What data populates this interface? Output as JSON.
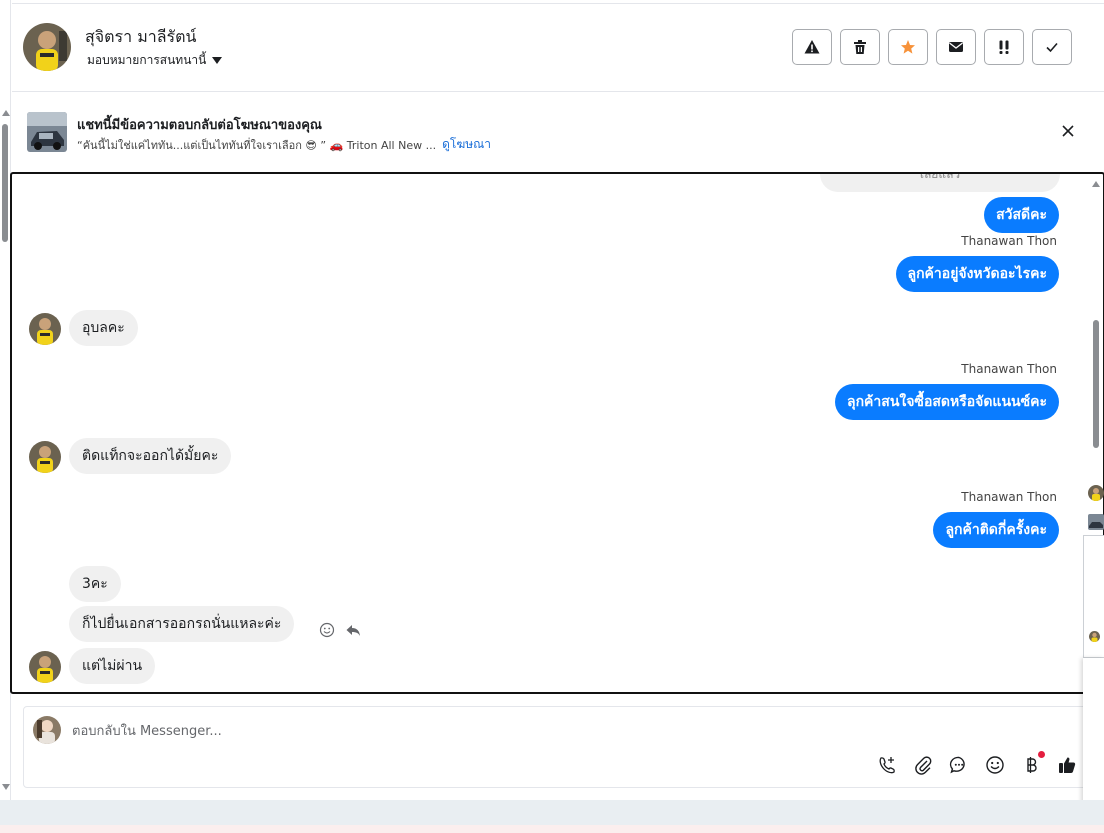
{
  "header": {
    "contact_name": "สุจิตรา มาลีรัตน์",
    "assign_label": "มอบหมายการสนทนานี้",
    "actions": [
      {
        "name": "report-spam-button",
        "icon": "warning-icon"
      },
      {
        "name": "delete-button",
        "icon": "trash-icon"
      },
      {
        "name": "star-button",
        "icon": "star-icon"
      },
      {
        "name": "mark-unread-button",
        "icon": "envelope-icon"
      },
      {
        "name": "follow-up-button",
        "icon": "exclamation-icon"
      },
      {
        "name": "mark-done-button",
        "icon": "check-icon"
      }
    ]
  },
  "ad_banner": {
    "title": "แชทนี้มีข้อความตอบกลับต่อโฆษณาของคุณ",
    "quote": "“คันนี้ไม่ใช่แค่ไททัน...แต่เป็นไททันที่ใจเราเลือก 😎 ” 🚗 Triton All New ...",
    "link_label": "ดูโฆษณา"
  },
  "conversation": {
    "previous_snippet": "เลยแล้ว",
    "messages": [
      {
        "direction": "out",
        "text": "สวัสดีคะ"
      },
      {
        "direction": "out",
        "sender": "Thanawan Thon",
        "text": "ลูกค้าอยู่จังหวัดอะไรคะ"
      },
      {
        "direction": "in",
        "text": "อุบลคะ"
      },
      {
        "direction": "out",
        "sender": "Thanawan Thon",
        "text": "ลุกค้าสนใจซื้อสดหรือจัดแนนซ์คะ"
      },
      {
        "direction": "in",
        "text": "ติดแท็กจะออกได้มั้ยคะ"
      },
      {
        "direction": "out",
        "sender": "Thanawan Thon",
        "text": "ลูกค้าติดกี่ครั้งคะ"
      },
      {
        "direction": "in",
        "text": "3คะ"
      },
      {
        "direction": "in",
        "text": "ก็ไปยื่นเอกสารออกรถนั่นแหละค่ะ"
      },
      {
        "direction": "in",
        "text": "แต่ไม่ผ่าน"
      }
    ]
  },
  "composer": {
    "placeholder": "ตอบกลับใน Messenger...",
    "tools": [
      "call-add-icon",
      "paperclip-icon",
      "saved-reply-icon",
      "emoji-icon",
      "payment-icon",
      "thumbs-up-icon"
    ]
  },
  "colors": {
    "outgoing_bubble": "#0a7cff",
    "incoming_bubble": "#f0f0f0",
    "star": "#f7923a",
    "link": "#1a6ed8"
  }
}
